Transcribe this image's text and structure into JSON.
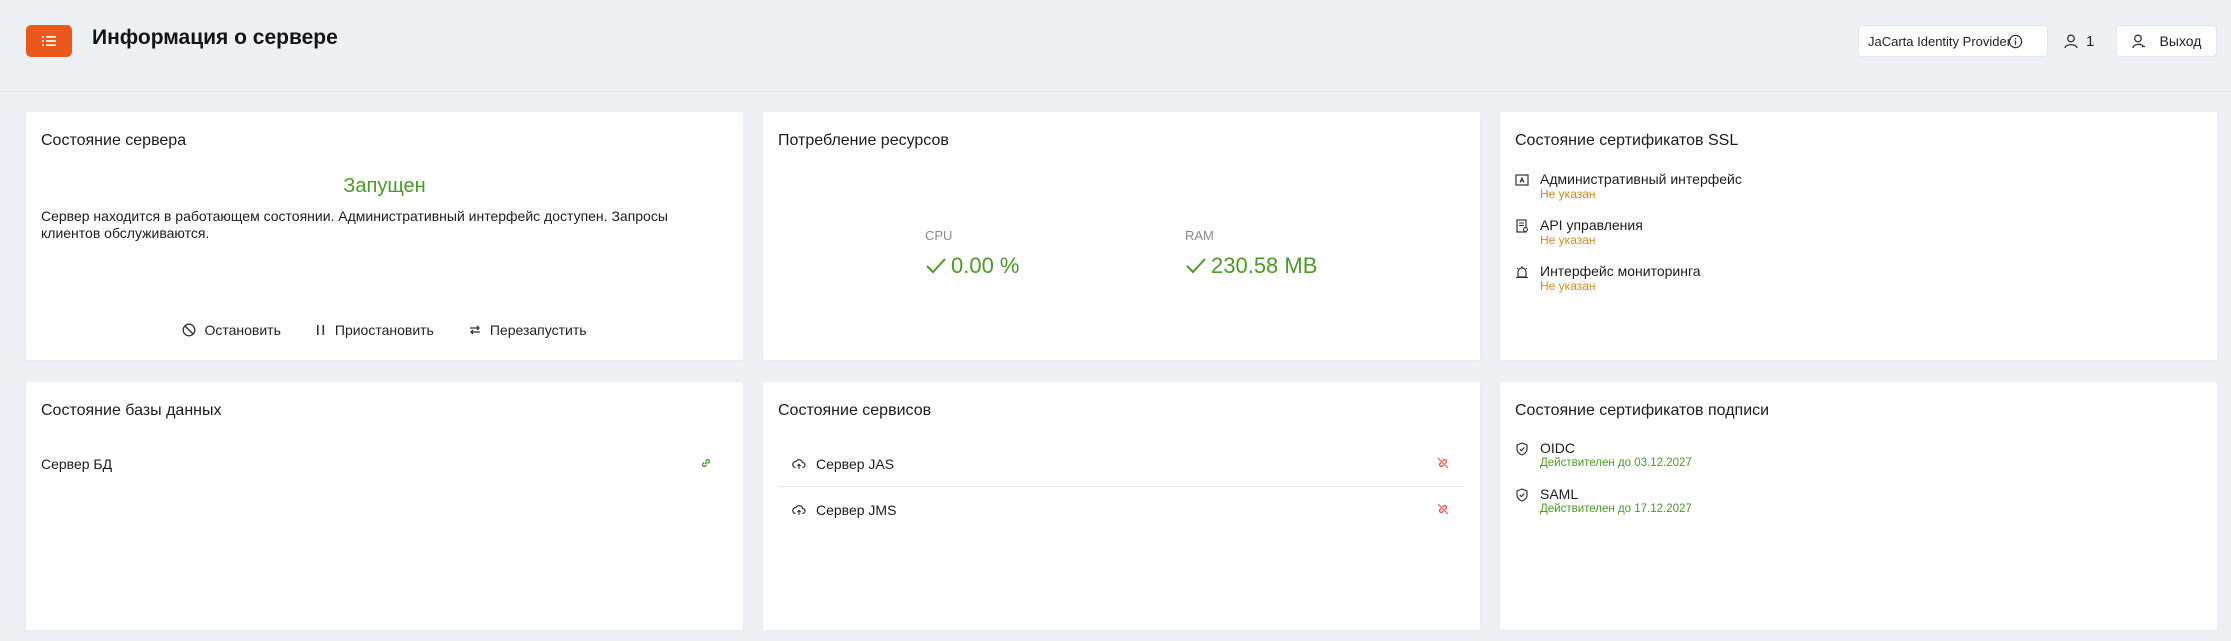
{
  "header": {
    "menu_icon": "menu-list-icon",
    "title": "Информация о сервере",
    "provider": "JaCarta Identity Provider",
    "users_count": "1",
    "logout_label": "Выход",
    "accent_color": "#e8591a"
  },
  "server_status": {
    "title": "Состояние сервера",
    "status": "Запущен",
    "description": "Сервер находится в работающем состоянии. Административный интерфейс доступен. Запросы клиентов обслуживаются.",
    "actions": [
      {
        "label": "Остановить",
        "icon": "stop-icon"
      },
      {
        "label": "Приостановить",
        "icon": "pause-icon"
      },
      {
        "label": "Перезапустить",
        "icon": "restart-icon"
      }
    ]
  },
  "resources": {
    "title": "Потребление ресурсов",
    "cpu_label": "CPU",
    "cpu_value": "0.00 %",
    "ram_label": "RAM",
    "ram_value": "230.58 MB"
  },
  "ssl_certs": {
    "title": "Состояние сертификатов SSL",
    "items": [
      {
        "name": "Административный интерфейс",
        "status": "Не указан",
        "icon": "admin-window-icon"
      },
      {
        "name": "API управления",
        "status": "Не указан",
        "icon": "api-doc-icon"
      },
      {
        "name": "Интерфейс мониторинга",
        "status": "Не указан",
        "icon": "monitor-alarm-icon"
      }
    ]
  },
  "database": {
    "title": "Состояние базы данных",
    "items": [
      {
        "name": "Сервер БД",
        "state_icon": "link-connected-icon"
      }
    ]
  },
  "services": {
    "title": "Состояние сервисов",
    "items": [
      {
        "name": "Сервер JAS",
        "state_icon": "link-broken-icon"
      },
      {
        "name": "Сервер JMS",
        "state_icon": "link-broken-icon"
      }
    ]
  },
  "sign_certs": {
    "title": "Состояние сертификатов подписи",
    "items": [
      {
        "name": "OIDC",
        "status": "Действителен до 03.12.2027",
        "icon": "shield-check-icon"
      },
      {
        "name": "SAML",
        "status": "Действителен до 17.12.2027",
        "icon": "shield-check-icon"
      }
    ]
  },
  "colors": {
    "ok": "#4a9a26",
    "warn": "#d08a1f",
    "error": "#e0544a"
  }
}
